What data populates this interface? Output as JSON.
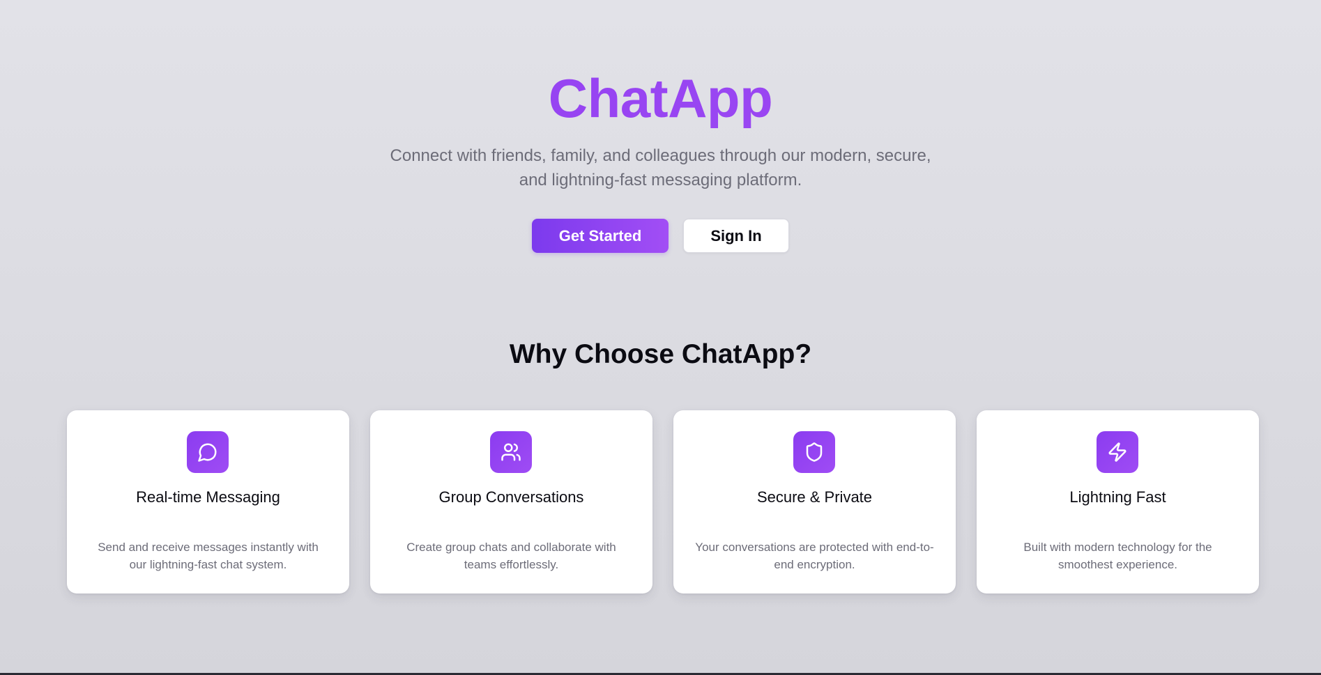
{
  "hero": {
    "title": "ChatApp",
    "tagline": "Connect with friends, family, and colleagues through our modern, secure, and lightning-fast messaging platform.",
    "primary_button": "Get Started",
    "secondary_button": "Sign In"
  },
  "features": {
    "heading": "Why Choose ChatApp?",
    "items": [
      {
        "icon": "message-circle-icon",
        "title": "Real-time Messaging",
        "description": "Send and receive messages instantly with our lightning-fast chat system."
      },
      {
        "icon": "users-icon",
        "title": "Group Conversations",
        "description": "Create group chats and collaborate with teams effortlessly."
      },
      {
        "icon": "shield-icon",
        "title": "Secure & Private",
        "description": "Your conversations are protected with end-to-end encryption."
      },
      {
        "icon": "lightning-icon",
        "title": "Lightning Fast",
        "description": "Built with modern technology for the smoothest experience."
      }
    ]
  },
  "colors": {
    "accent": "#9b45f0",
    "accent_dark": "#7c3aed",
    "text_primary": "#0b0b12",
    "text_muted": "#6c6c78",
    "background": "#dedee4"
  }
}
